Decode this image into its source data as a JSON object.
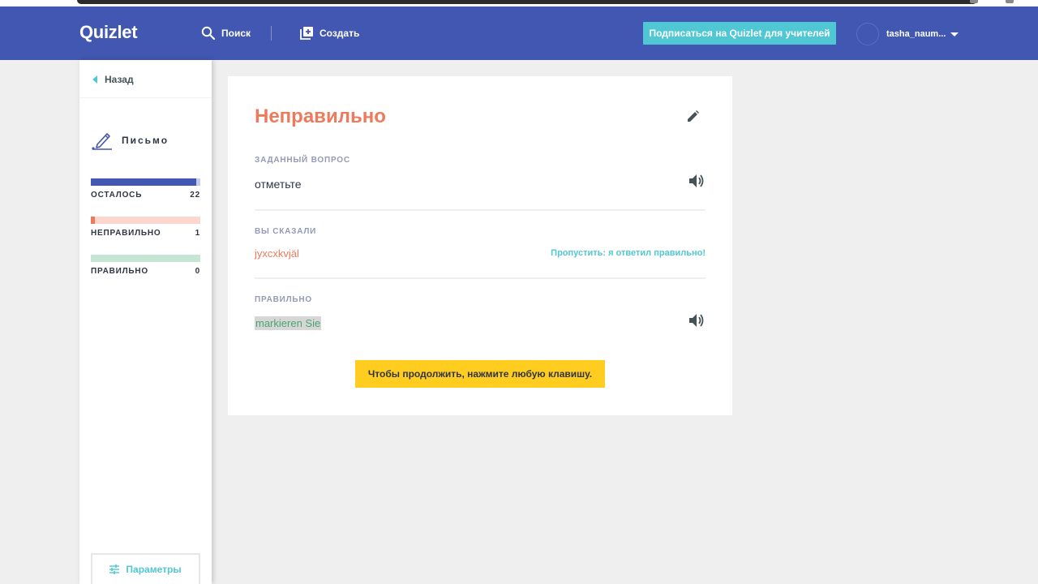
{
  "header": {
    "logo": "Quizlet",
    "search_label": "Поиск",
    "create_label": "Создать",
    "teacher_button": "Подписаться на Quizlet для учителей",
    "username": "tasha_naum..."
  },
  "sidebar": {
    "back_label": "Назад",
    "mode_label": "Письмо",
    "progress": [
      {
        "label": "ОСТАЛОСЬ",
        "count": "22",
        "color": "#4257b2",
        "track": "#c4cbea",
        "fraction": 0.96
      },
      {
        "label": "НЕПРАВИЛЬНО",
        "count": "1",
        "color": "#ee7a5c",
        "track": "#fdd6cd",
        "fraction": 0.04
      },
      {
        "label": "ПРАВИЛЬНО",
        "count": "0",
        "color": "#4aa56f",
        "track": "#c5e6d2",
        "fraction": 0.0
      }
    ],
    "params_label": "Параметры"
  },
  "card": {
    "title": "Неправильно",
    "question_label": "ЗАДАННЫЙ ВОПРОС",
    "question_text": "отметьте",
    "answer_label": "ВЫ СКАЗАЛИ",
    "answer_text": "jyxcxkvjäl",
    "override_label": "Пропустить: я ответил правильно!",
    "correct_label": "ПРАВИЛЬНО",
    "correct_text": "markieren Sie",
    "continue_label": "Чтобы продолжить, нажмите любую клавишу."
  },
  "colors": {
    "header_bg": "#4257b2",
    "accent": "#4fc8d4",
    "incorrect": "#ee7a5c",
    "correct": "#4aa56f",
    "continue_bg": "#ffcd1f"
  }
}
